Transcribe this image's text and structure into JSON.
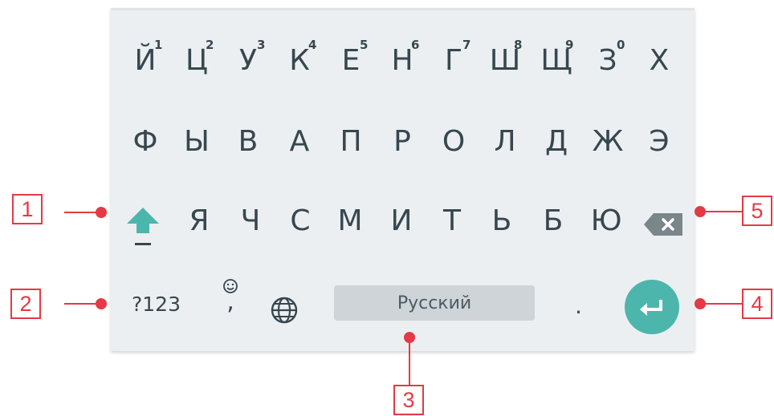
{
  "keyboard": {
    "row1": [
      {
        "letter": "Й",
        "hint": "1"
      },
      {
        "letter": "Ц",
        "hint": "2"
      },
      {
        "letter": "У",
        "hint": "3"
      },
      {
        "letter": "К",
        "hint": "4"
      },
      {
        "letter": "Е",
        "hint": "5"
      },
      {
        "letter": "Н",
        "hint": "6"
      },
      {
        "letter": "Г",
        "hint": "7"
      },
      {
        "letter": "Ш",
        "hint": "8"
      },
      {
        "letter": "Щ",
        "hint": "9"
      },
      {
        "letter": "З",
        "hint": "0"
      },
      {
        "letter": "Х",
        "hint": ""
      }
    ],
    "row2": [
      "Ф",
      "Ы",
      "В",
      "А",
      "П",
      "Р",
      "О",
      "Л",
      "Д",
      "Ж",
      "Э"
    ],
    "row3": [
      "Я",
      "Ч",
      "С",
      "М",
      "И",
      "Т",
      "Ь",
      "Б",
      "Ю"
    ],
    "symbols_label": "?123",
    "emoji_comma": ",",
    "space_label": "Русский",
    "period_label": ".",
    "shift_icon": "shift-arrow-icon",
    "backspace_icon": "backspace-icon",
    "globe_icon": "globe-icon",
    "enter_icon": "enter-return-icon",
    "accent_color": "#4db6ac",
    "key_text_color": "#37474f"
  },
  "callouts": [
    "1",
    "2",
    "3",
    "4",
    "5"
  ],
  "callout_color": "#e53945"
}
